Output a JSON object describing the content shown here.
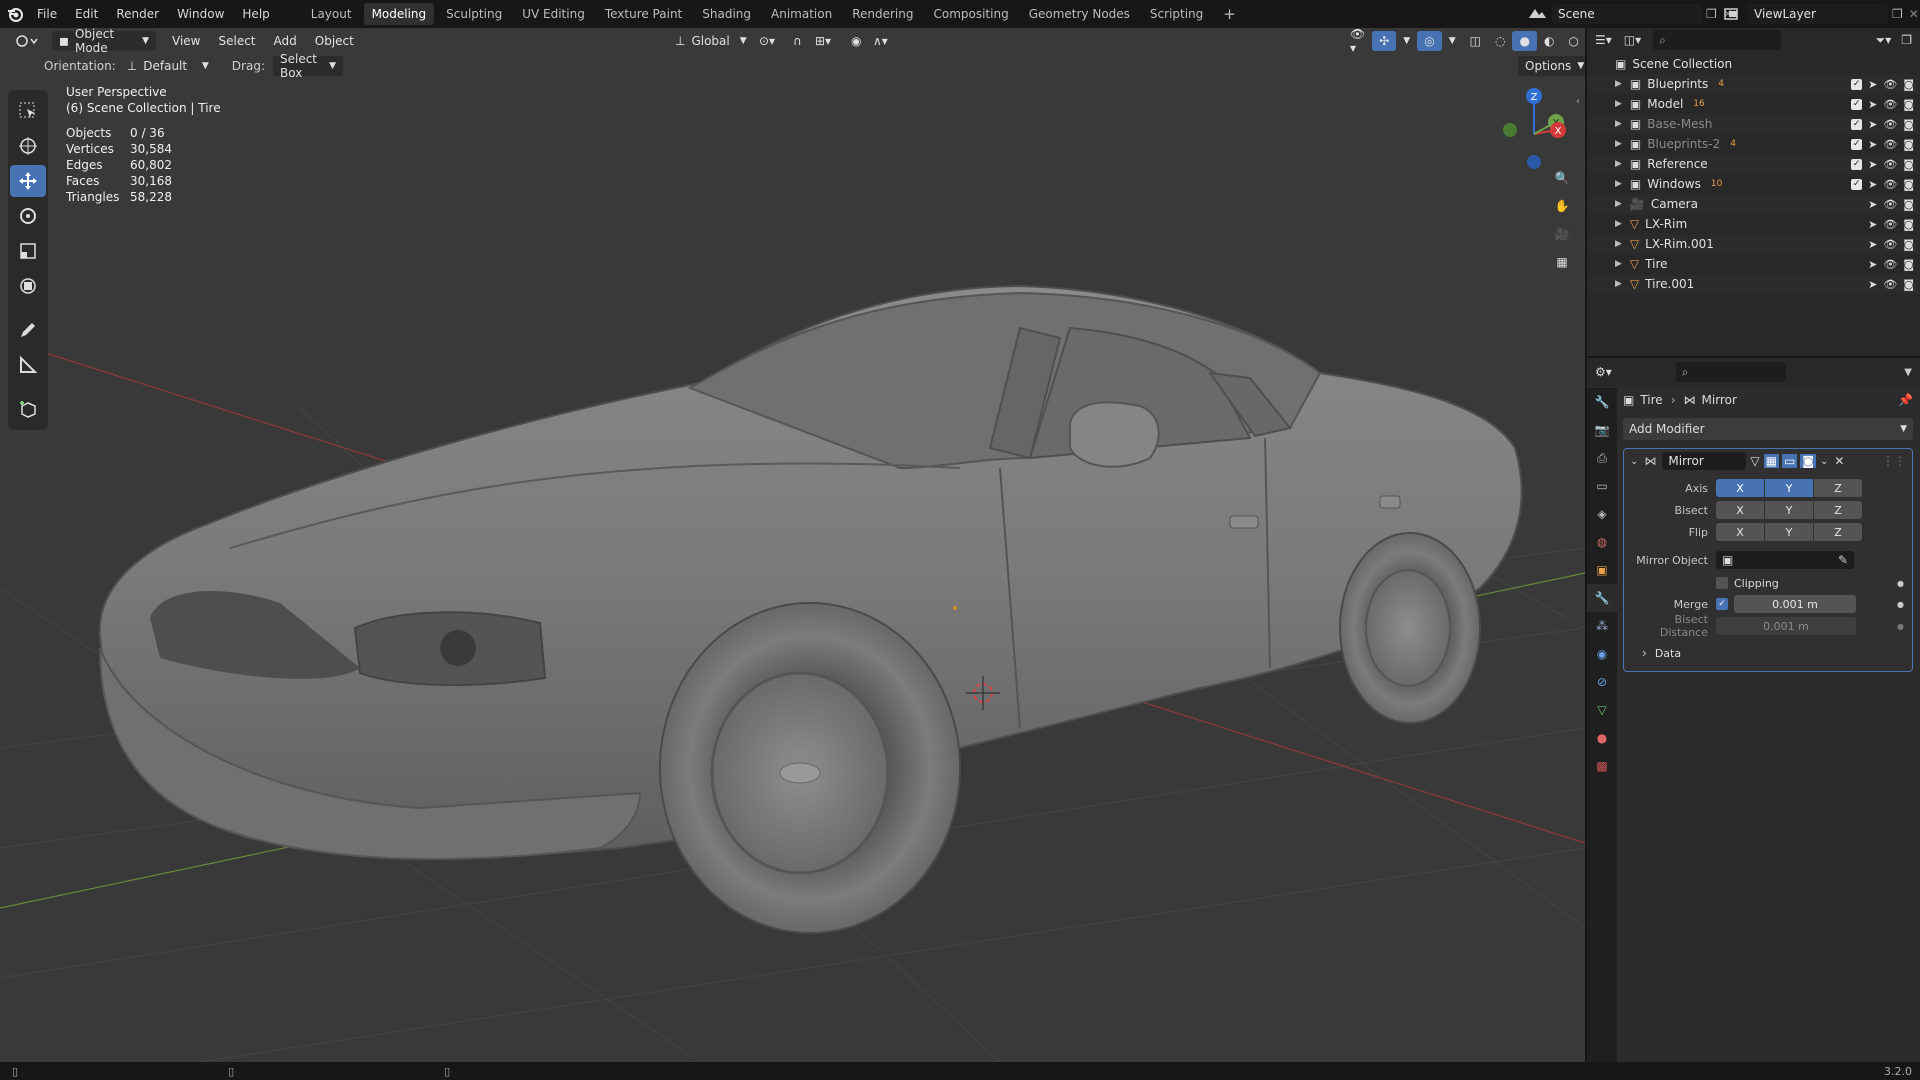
{
  "menu": [
    "File",
    "Edit",
    "Render",
    "Window",
    "Help"
  ],
  "workspaces": [
    {
      "label": "Layout",
      "active": false
    },
    {
      "label": "Modeling",
      "active": true
    },
    {
      "label": "Sculpting",
      "active": false
    },
    {
      "label": "UV Editing",
      "active": false
    },
    {
      "label": "Texture Paint",
      "active": false
    },
    {
      "label": "Shading",
      "active": false
    },
    {
      "label": "Animation",
      "active": false
    },
    {
      "label": "Rendering",
      "active": false
    },
    {
      "label": "Compositing",
      "active": false
    },
    {
      "label": "Geometry Nodes",
      "active": false
    },
    {
      "label": "Scripting",
      "active": false
    }
  ],
  "scene": {
    "name": "Scene",
    "view_layer": "ViewLayer"
  },
  "viewport": {
    "mode": "Object Mode",
    "menus": [
      "View",
      "Select",
      "Add",
      "Object"
    ],
    "transform_orientation": "Global",
    "orientation_label": "Orientation:",
    "orientation_value": "Default",
    "drag_label": "Drag:",
    "drag_value": "Select Box",
    "options_label": "Options",
    "perspective": "User Perspective",
    "collection_info": "(6) Scene Collection | Tire",
    "stats": [
      {
        "k": "Objects",
        "v": "0 / 36"
      },
      {
        "k": "Vertices",
        "v": "30,584"
      },
      {
        "k": "Edges",
        "v": "60,802"
      },
      {
        "k": "Faces",
        "v": "30,168"
      },
      {
        "k": "Triangles",
        "v": "58,228"
      }
    ]
  },
  "gizmo": {
    "z": "Z",
    "y": "Y",
    "x": "X"
  },
  "outliner": {
    "root": "Scene Collection",
    "items": [
      {
        "label": "Blueprints",
        "type": "collection",
        "dim": false,
        "badge": "4",
        "checked": true
      },
      {
        "label": "Model",
        "type": "collection",
        "dim": false,
        "badge": "16",
        "checked": true
      },
      {
        "label": "Base-Mesh",
        "type": "collection",
        "dim": true,
        "badge": "",
        "checked": true
      },
      {
        "label": "Blueprints-2",
        "type": "collection",
        "dim": true,
        "badge": "4",
        "checked": true
      },
      {
        "label": "Reference",
        "type": "collection",
        "dim": false,
        "badge": "",
        "checked": true
      },
      {
        "label": "Windows",
        "type": "collection",
        "dim": false,
        "badge": "10",
        "checked": true
      },
      {
        "label": "Camera",
        "type": "camera",
        "dim": false,
        "badge": "",
        "checked": false
      },
      {
        "label": "LX-Rim",
        "type": "mesh",
        "dim": false,
        "badge": "",
        "checked": false
      },
      {
        "label": "LX-Rim.001",
        "type": "mesh",
        "dim": false,
        "badge": "",
        "checked": false
      },
      {
        "label": "Tire",
        "type": "mesh",
        "dim": false,
        "badge": "",
        "checked": false
      },
      {
        "label": "Tire.001",
        "type": "mesh",
        "dim": false,
        "badge": "",
        "checked": false
      }
    ]
  },
  "properties": {
    "breadcrumb_object": "Tire",
    "breadcrumb_modifier": "Mirror",
    "add_modifier": "Add Modifier",
    "modifier_name": "Mirror",
    "axis_label": "Axis",
    "bisect_label": "Bisect",
    "flip_label": "Flip",
    "xyz": [
      "X",
      "Y",
      "Z"
    ],
    "mirror_object_label": "Mirror Object",
    "clipping_label": "Clipping",
    "merge_label": "Merge",
    "merge_value": "0.001 m",
    "bisect_distance_label": "Bisect Distance",
    "bisect_distance_value": "0.001 m",
    "data_label": "Data"
  },
  "status": {
    "version": "3.2.0"
  },
  "colors": {
    "accent": "#4772b3",
    "bg": "#393939",
    "panel": "#2c2c2c"
  }
}
